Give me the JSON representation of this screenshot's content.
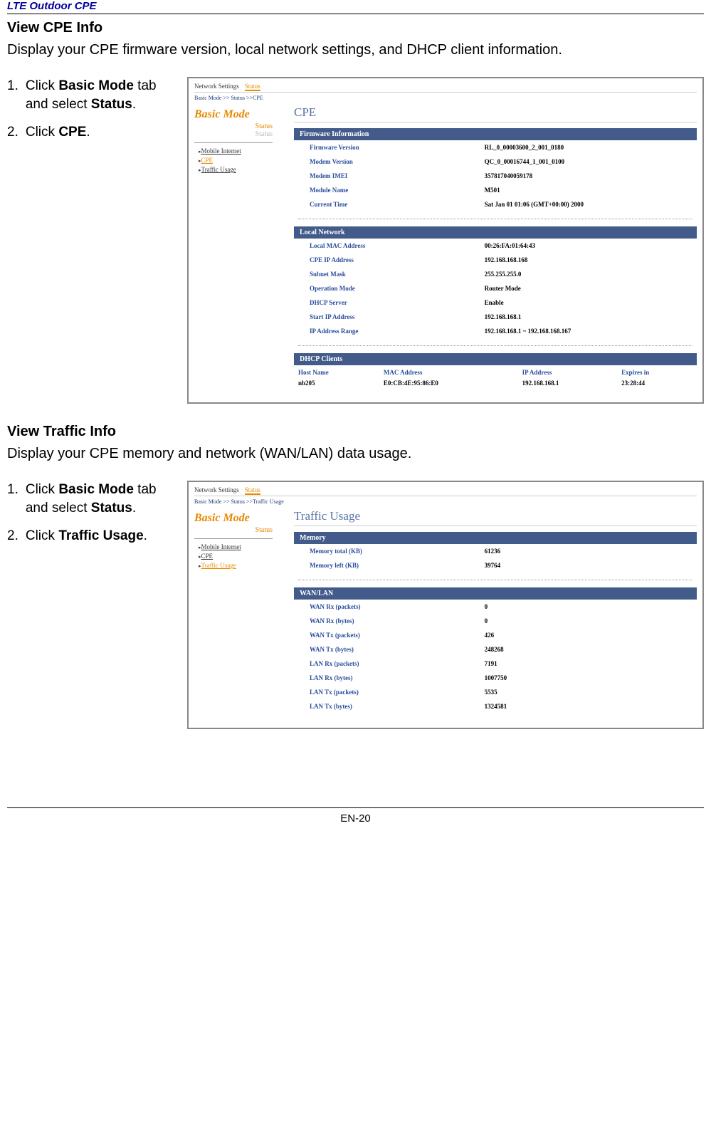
{
  "doc": {
    "header": "LTE Outdoor CPE",
    "page_number": "EN-20"
  },
  "section1": {
    "title": "View CPE Info",
    "desc": "Display your CPE firmware version, local network settings, and DHCP client information.",
    "step1_num": "1.",
    "step1_pre": "Click ",
    "step1_bold1": "Basic Mode",
    "step1_mid": " tab and select ",
    "step1_bold2": "Status",
    "step1_post": ".",
    "step2_num": "2.",
    "step2_pre": "Click ",
    "step2_bold1": "CPE",
    "step2_post": "."
  },
  "shot1": {
    "tabs": {
      "network": "Network Settings",
      "status": "Status"
    },
    "breadcrumb": "Basic Mode >> Status >>CPE",
    "mode": "Basic Mode",
    "status1": "Status",
    "status2": "Status",
    "side": {
      "mobile": "Mobile Internet",
      "cpe": "CPE",
      "traffic": "Traffic Usage"
    },
    "page_title": "CPE",
    "panel_firmware": "Firmware Information",
    "fw": {
      "k1": "Firmware Version",
      "v1": "RL_0_00003600_2_001_0180",
      "k2": "Modem Version",
      "v2": "QC_0_00016744_1_001_0100",
      "k3": "Modem IMEI",
      "v3": "357817040059178",
      "k4": "Module Name",
      "v4": "M501",
      "k5": "Current Time",
      "v5": "Sat Jan 01 01:06 (GMT+00:00) 2000"
    },
    "panel_local": "Local Network",
    "ln": {
      "k1": "Local MAC Address",
      "v1": "00:26:FA:01:64:43",
      "k2": "CPE IP Address",
      "v2": "192.168.168.168",
      "k3": "Subnet Mask",
      "v3": "255.255.255.0",
      "k4": "Operation Mode",
      "v4": "Router Mode",
      "k5": "DHCP Server",
      "v5": "Enable",
      "k6": "Start IP Address",
      "v6": "192.168.168.1",
      "k7": "IP Address Range",
      "v7": "192.168.168.1 ~ 192.168.168.167"
    },
    "panel_dhcp": "DHCP Clients",
    "dhcp_headers": {
      "h1": "Host Name",
      "h2": "MAC Address",
      "h3": "IP Address",
      "h4": "Expires in"
    },
    "dhcp_row": {
      "c1": "nb205",
      "c2": "E0:CB:4E:95:86:E0",
      "c3": "192.168.168.1",
      "c4": "23:28:44"
    }
  },
  "section2": {
    "title": "View Traffic Info",
    "desc": "Display your CPE memory and network (WAN/LAN) data usage.",
    "step1_num": "1.",
    "step1_pre": "Click ",
    "step1_bold1": "Basic Mode",
    "step1_mid": " tab and select ",
    "step1_bold2": "Status",
    "step1_post": ".",
    "step2_num": "2.",
    "step2_pre": "Click ",
    "step2_bold1": "Traffic Usage",
    "step2_post": "."
  },
  "shot2": {
    "tabs": {
      "network": "Network Settings",
      "status": "Status"
    },
    "breadcrumb": "Basic Mode >> Status >>Traffic Usage",
    "mode": "Basic Mode",
    "status1": "Status",
    "side": {
      "mobile": "Mobile Internet",
      "cpe": "CPE",
      "traffic": "Traffic Usage"
    },
    "page_title": "Traffic Usage",
    "panel_mem": "Memory",
    "mem": {
      "k1": "Memory total (KB)",
      "v1": "61236",
      "k2": "Memory left (KB)",
      "v2": "39764"
    },
    "panel_wanlan": "WAN/LAN",
    "wl": {
      "k1": "WAN Rx (packets)",
      "v1": "0",
      "k2": "WAN Rx (bytes)",
      "v2": "0",
      "k3": "WAN Tx (packets)",
      "v3": "426",
      "k4": "WAN Tx (bytes)",
      "v4": "248268",
      "k5": "LAN Rx (packets)",
      "v5": "7191",
      "k6": "LAN Rx (bytes)",
      "v6": "1007750",
      "k7": "LAN Tx (packets)",
      "v7": "5535",
      "k8": "LAN Tx (bytes)",
      "v8": "1324581"
    }
  }
}
